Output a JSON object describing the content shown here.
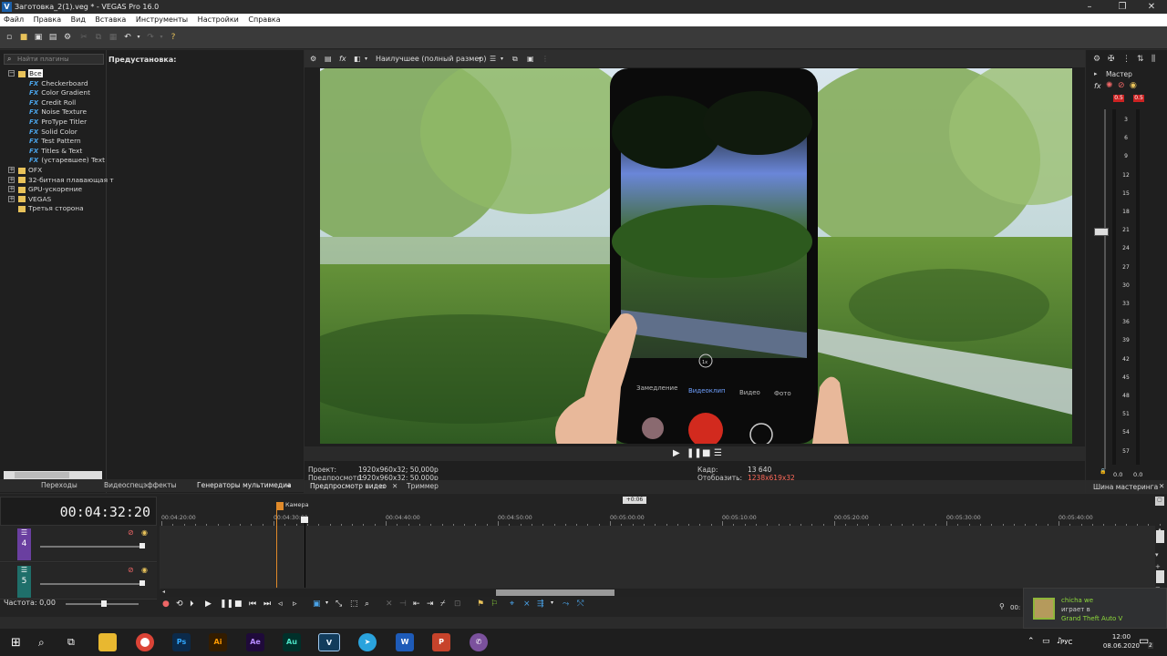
{
  "window": {
    "title": "Заготовка_2(1).veg * - VEGAS Pro 16.0",
    "icon": "V"
  },
  "menu": [
    "Файл",
    "Правка",
    "Вид",
    "Вставка",
    "Инструменты",
    "Настройки",
    "Справка"
  ],
  "plugins": {
    "search_placeholder": "Найти плагины",
    "preset_label": "Предустановка:",
    "tree": [
      {
        "label": "Все",
        "type": "folder-root"
      },
      {
        "label": "Checkerboard",
        "type": "fx"
      },
      {
        "label": "Color Gradient",
        "type": "fx"
      },
      {
        "label": "Credit Roll",
        "type": "fx"
      },
      {
        "label": "Noise Texture",
        "type": "fx"
      },
      {
        "label": "ProType Titler",
        "type": "fx"
      },
      {
        "label": "Solid Color",
        "type": "fx"
      },
      {
        "label": "Test Pattern",
        "type": "fx"
      },
      {
        "label": "Titles & Text",
        "type": "fx"
      },
      {
        "label": "(устаревшее) Text",
        "type": "fx"
      },
      {
        "label": "OFX",
        "type": "folder"
      },
      {
        "label": "32-битная плавающая т",
        "type": "folder"
      },
      {
        "label": "GPU-ускорение",
        "type": "folder"
      },
      {
        "label": "VEGAS",
        "type": "folder"
      },
      {
        "label": "Третья сторона",
        "type": "folder-leaf"
      }
    ],
    "tabs": [
      "Переходы",
      "Видеоспецэффекты",
      "Генераторы мультимедиа"
    ]
  },
  "preview": {
    "quality": "Наилучшее (полный размер)",
    "camera_ui": {
      "modes": [
        "Замедление",
        "Видеоклип",
        "Видео",
        "Фото"
      ],
      "zoom": "1x"
    },
    "info": {
      "project_label": "Проект:",
      "project_value": "1920x960x32; 50,000p",
      "preview_label": "Предпросмотр:",
      "preview_value": "1920x960x32; 50,000p",
      "frame_label": "Кадр:",
      "frame_value": "13 640",
      "display_label": "Отобразить:",
      "display_value": "1238x619x32"
    },
    "tabs": [
      "Предпросмотр видео",
      "Триммер"
    ]
  },
  "master": {
    "label": "Мастер",
    "peak_left": "0.5",
    "peak_right": "0.5",
    "scale": [
      "3",
      "6",
      "9",
      "12",
      "15",
      "18",
      "21",
      "24",
      "27",
      "30",
      "33",
      "36",
      "39",
      "42",
      "45",
      "48",
      "51",
      "54",
      "57"
    ],
    "bottom_left": "0.0",
    "bottom_right": "0.0",
    "tab": "Шина мастеринга"
  },
  "timeline": {
    "timecode": "00:04:32:20",
    "tracks": [
      {
        "num": "4"
      },
      {
        "num": "5"
      }
    ],
    "ruler": [
      "00:04:20:00",
      "00:04:30:00",
      "00:04:40:00",
      "00:04:50:00",
      "00:05:00:00",
      "00:05:10:00",
      "00:05:20:00",
      "00:05:30:00",
      "00:05:40:00"
    ],
    "marker": "Камера",
    "loop_label": "+0:06",
    "rate": "Частота: 0,00",
    "end_time": "00:"
  },
  "notification": {
    "name": "chicha we",
    "action": "играет в",
    "game": "Grand Theft Auto V"
  },
  "taskbar": {
    "apps": [
      {
        "label": "Ps",
        "color": "#0b2a4a",
        "text": "#31a8ff"
      },
      {
        "label": "Ai",
        "color": "#331c00",
        "text": "#ff9a00"
      },
      {
        "label": "Ae",
        "color": "#1f0a3a",
        "text": "#b58bff"
      },
      {
        "label": "Au",
        "color": "#00302a",
        "text": "#4be3c6"
      },
      {
        "label": "V",
        "color": "#123c5c",
        "text": "#e8f4ff"
      },
      {
        "label": "W",
        "color": "#1e5bb8",
        "text": "#ffffff"
      },
      {
        "label": "P",
        "color": "#c7432b",
        "text": "#ffffff"
      }
    ],
    "lang": "РУС",
    "time": "12:00",
    "date": "08.06.2020",
    "notif_count": "2"
  }
}
